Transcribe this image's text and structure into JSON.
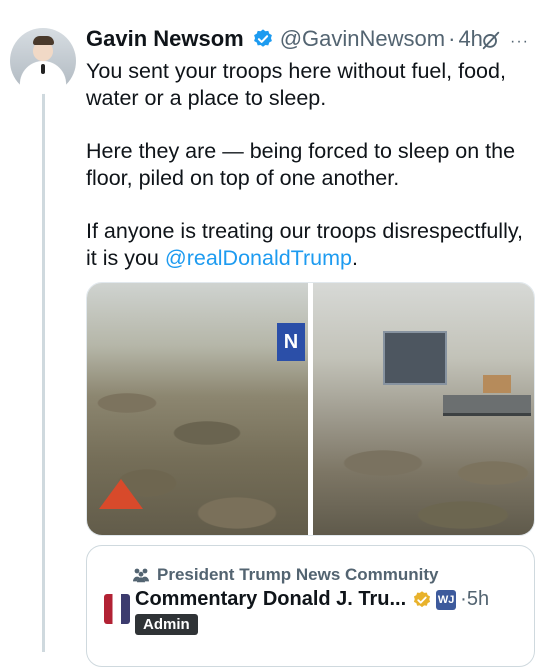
{
  "tweet": {
    "author_name": "Gavin Newsom",
    "handle": "@GavinNewsom",
    "separator": "·",
    "time": "4h",
    "more_label": "···",
    "paragraphs": [
      "You sent your troops here without fuel, food, water or a place to sleep.",
      "Here they are — being forced to sleep on the floor, piled on top of one another."
    ],
    "last_paragraph_text": "If anyone is treating our troops disrespectfully, it is you ",
    "mention": "@realDonaldTrump",
    "last_paragraph_end": "."
  },
  "media": {
    "photo_1_sign": "N"
  },
  "quote": {
    "community": "President Trump News Community",
    "author_name": "Commentary Donald J. Tru...",
    "badge_text": "WJ",
    "separator": "·",
    "time": "5h",
    "role_badge": "Admin"
  },
  "colors": {
    "accent": "#1d9bf0",
    "secondary_text": "#536471",
    "verified_gold": "#e8b22c"
  }
}
